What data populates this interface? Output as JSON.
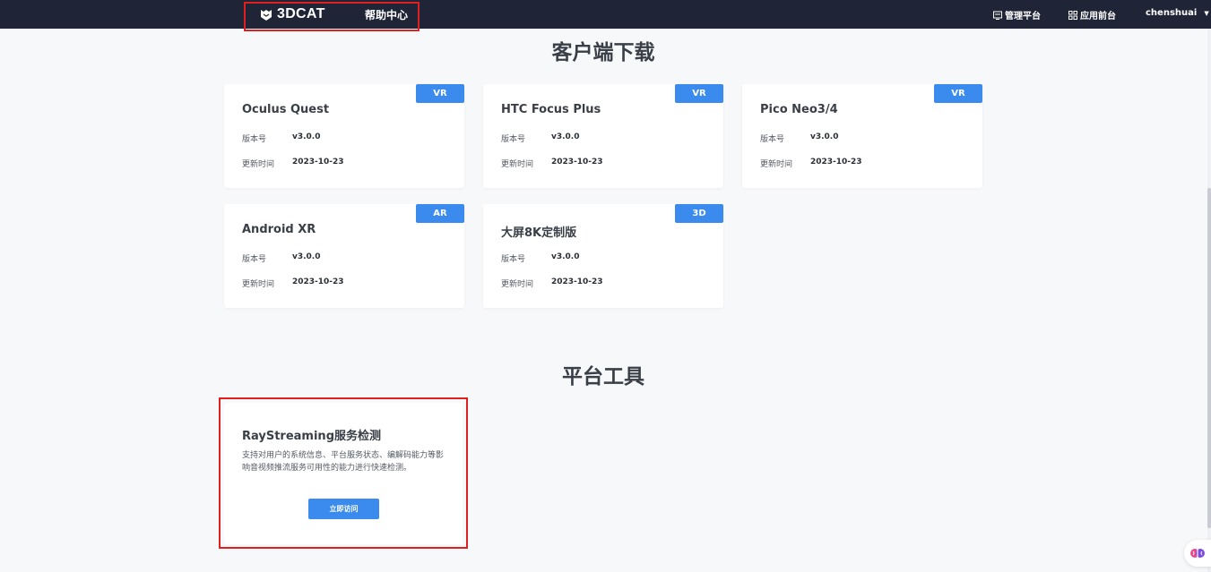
{
  "header": {
    "brand": "3DCAT",
    "help_center": "帮助中心",
    "nav": {
      "admin": "管理平台",
      "apps": "应用前台",
      "user": "chenshuai"
    },
    "icons": {
      "logo": "cat-logo-icon",
      "admin": "admin-panel-icon",
      "apps": "apps-grid-icon",
      "caret": "caret-down-icon"
    }
  },
  "sections": {
    "download_title": "客户端下载",
    "tools_title": "平台工具"
  },
  "labels": {
    "version": "版本号",
    "updated": "更新时间"
  },
  "clients": [
    {
      "name": "Oculus Quest",
      "tag": "VR",
      "version": "v3.0.0",
      "date": "2023-10-23"
    },
    {
      "name": "HTC Focus Plus",
      "tag": "VR",
      "version": "v3.0.0",
      "date": "2023-10-23"
    },
    {
      "name": "Pico Neo3/4",
      "tag": "VR",
      "version": "v3.0.0",
      "date": "2023-10-23"
    },
    {
      "name": "Android XR",
      "tag": "AR",
      "version": "v3.0.0",
      "date": "2023-10-23"
    },
    {
      "name": "大屏8K定制版",
      "tag": "3D",
      "version": "v3.0.0",
      "date": "2023-10-23"
    }
  ],
  "tool": {
    "name": "RayStreaming服务检测",
    "description": "支持对用户的系统信息、平台服务状态、编解码能力等影响音视频推流服务可用性的能力进行快速检测。",
    "button": "立即访问"
  },
  "colors": {
    "topbar": "#1f2437",
    "accent": "#3a8bed",
    "highlight": "#e02020",
    "background": "#f7f8fa"
  }
}
